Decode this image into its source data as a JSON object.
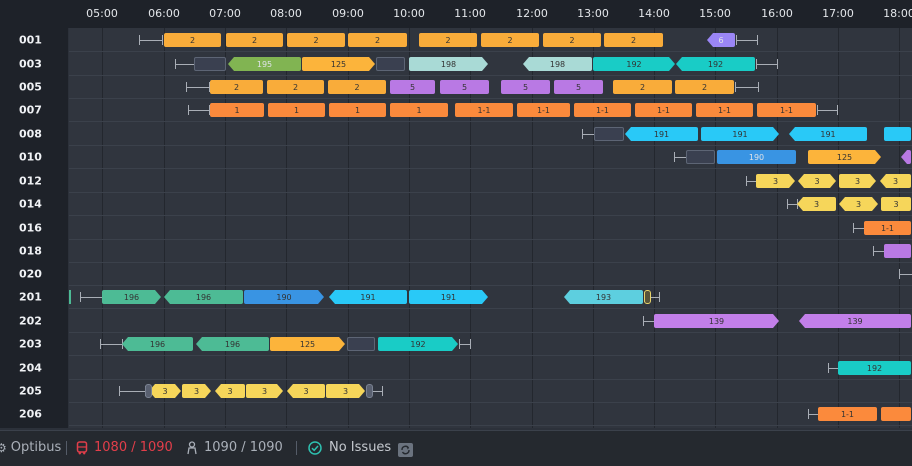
{
  "timeline": {
    "hours": [
      "05:00",
      "06:00",
      "07:00",
      "08:00",
      "09:00",
      "10:00",
      "11:00",
      "12:00",
      "13:00",
      "14:00",
      "15:00",
      "16:00",
      "17:00",
      "18:00"
    ]
  },
  "colors": {
    "route_2": "#f9ac3a",
    "route_1": "#fb8a3c",
    "route_3": "#f6d65a",
    "route_5": "#b979e4",
    "route_6": "#9b86f6",
    "route_195": "#81b452",
    "route_125": "#fcb43b",
    "route_198": "#a9dad6",
    "route_192": "#19ccc6",
    "route_191": "#29c9f7",
    "route_190": "#3994e3",
    "route_193": "#5dcfdf",
    "route_196": "#4dbb95",
    "route_139": "#c27fe9",
    "gap": "#3a4050",
    "alert_red": "#e23e4a",
    "ok_teal": "#2ec0b0"
  },
  "rows": [
    {
      "id": "001",
      "blocks": [
        "2",
        "2",
        "2",
        "2",
        "2",
        "2",
        "2",
        "2",
        "6"
      ]
    },
    {
      "id": "003",
      "blocks": [
        "195",
        "125",
        "198",
        "198",
        "192",
        "192"
      ]
    },
    {
      "id": "005",
      "blocks": [
        "2",
        "2",
        "2",
        "5",
        "5",
        "5",
        "5",
        "2",
        "2"
      ]
    },
    {
      "id": "007",
      "blocks": [
        "1",
        "1",
        "1",
        "1",
        "1-1",
        "1-1",
        "1-1",
        "1-1",
        "1-1",
        "1-1"
      ]
    },
    {
      "id": "008",
      "blocks": [
        "191",
        "191",
        "191"
      ]
    },
    {
      "id": "010",
      "blocks": [
        "190",
        "125"
      ]
    },
    {
      "id": "012",
      "blocks": [
        "3",
        "3",
        "3",
        "3"
      ]
    },
    {
      "id": "014",
      "blocks": [
        "3",
        "3",
        "3"
      ]
    },
    {
      "id": "016",
      "blocks": [
        "1-1"
      ]
    },
    {
      "id": "018",
      "blocks": []
    },
    {
      "id": "020",
      "blocks": []
    },
    {
      "id": "201",
      "blocks": [
        "196",
        "196",
        "190",
        "191",
        "191",
        "193"
      ]
    },
    {
      "id": "202",
      "blocks": [
        "139",
        "139"
      ]
    },
    {
      "id": "203",
      "blocks": [
        "196",
        "196",
        "125",
        "192"
      ]
    },
    {
      "id": "204",
      "blocks": [
        "192"
      ]
    },
    {
      "id": "205",
      "blocks": [
        "3",
        "3",
        "3",
        "3",
        "3",
        "3"
      ]
    },
    {
      "id": "206",
      "blocks": [
        "1-1"
      ]
    }
  ],
  "status_bar": {
    "brand": "Optibus",
    "vehicles": "1080 / 1090",
    "drivers": "1090 / 1090",
    "issues": "No Issues"
  }
}
